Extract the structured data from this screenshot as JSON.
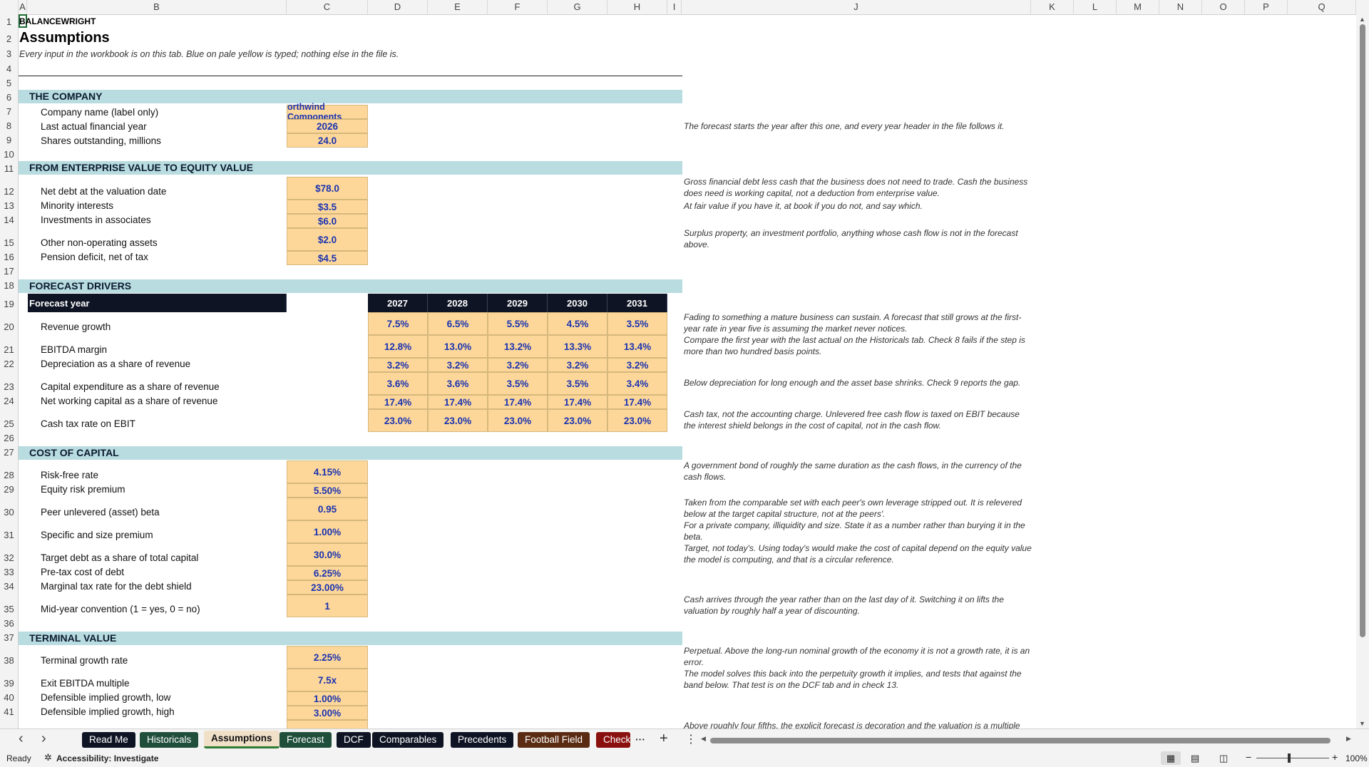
{
  "columns": [
    "A",
    "B",
    "C",
    "D",
    "E",
    "F",
    "G",
    "H",
    "I",
    "J",
    "K",
    "L",
    "M",
    "N",
    "O",
    "P",
    "Q"
  ],
  "rows": [
    "1",
    "2",
    "3",
    "4",
    "5",
    "6",
    "7",
    "8",
    "9",
    "10",
    "11",
    "12",
    "13",
    "14",
    "15",
    "16",
    "17",
    "18",
    "19",
    "20",
    "21",
    "22",
    "23",
    "24",
    "25",
    "26",
    "27",
    "28",
    "29",
    "30",
    "31",
    "32",
    "33",
    "34",
    "35",
    "36",
    "37",
    "38",
    "39",
    "40",
    "41"
  ],
  "brand": "BALANCEWRIGHT",
  "title": "Assumptions",
  "subtitle": "Every input in the workbook is on this tab. Blue on pale yellow is typed; nothing else in the file is.",
  "sections": {
    "company": "THE COMPANY",
    "ev": "FROM ENTERPRISE VALUE TO EQUITY VALUE",
    "drivers": "FORECAST DRIVERS",
    "coc": "COST OF CAPITAL",
    "tv": "TERMINAL VALUE"
  },
  "company": {
    "name_label": "Company name (label only)",
    "name_value": "orthwind Components",
    "year_label": "Last actual financial year",
    "year_value": "2026",
    "shares_label": "Shares outstanding, millions",
    "shares_value": "24.0"
  },
  "ev": {
    "net_debt_label": "Net debt at the valuation date",
    "net_debt_value": "$78.0",
    "minority_label": "Minority interests",
    "minority_value": "$3.5",
    "assoc_label": "Investments in associates",
    "assoc_value": "$6.0",
    "other_label": "Other non-operating assets",
    "other_value": "$2.0",
    "pension_label": "Pension deficit, net of tax",
    "pension_value": "$4.5"
  },
  "drivers": {
    "header_label": "Forecast year",
    "years": [
      "2027",
      "2028",
      "2029",
      "2030",
      "2031"
    ],
    "rows": [
      {
        "label": "Revenue growth",
        "values": [
          "7.5%",
          "6.5%",
          "5.5%",
          "4.5%",
          "3.5%"
        ]
      },
      {
        "label": "EBITDA margin",
        "values": [
          "12.8%",
          "13.0%",
          "13.2%",
          "13.3%",
          "13.4%"
        ]
      },
      {
        "label": "Depreciation as a share of revenue",
        "values": [
          "3.2%",
          "3.2%",
          "3.2%",
          "3.2%",
          "3.2%"
        ]
      },
      {
        "label": "Capital expenditure as a share of revenue",
        "values": [
          "3.6%",
          "3.6%",
          "3.5%",
          "3.5%",
          "3.4%"
        ]
      },
      {
        "label": "Net working capital as a share of revenue",
        "values": [
          "17.4%",
          "17.4%",
          "17.4%",
          "17.4%",
          "17.4%"
        ]
      },
      {
        "label": "Cash tax rate on EBIT",
        "values": [
          "23.0%",
          "23.0%",
          "23.0%",
          "23.0%",
          "23.0%"
        ]
      }
    ]
  },
  "coc": {
    "rf_label": "Risk-free rate",
    "rf_value": "4.15%",
    "erp_label": "Equity risk premium",
    "erp_value": "5.50%",
    "beta_label": "Peer unlevered (asset) beta",
    "beta_value": "0.95",
    "size_label": "Specific and size premium",
    "size_value": "1.00%",
    "debt_share_label": "Target debt as a share of total capital",
    "debt_share_value": "30.0%",
    "kd_label": "Pre-tax cost of debt",
    "kd_value": "6.25%",
    "tax_label": "Marginal tax rate for the debt shield",
    "tax_value": "23.00%",
    "midyear_label": "Mid-year convention (1 = yes, 0 = no)",
    "midyear_value": "1"
  },
  "tv": {
    "g_label": "Terminal growth rate",
    "g_value": "2.25%",
    "exit_label": "Exit EBITDA multiple",
    "exit_value": "7.5x",
    "low_label": "Defensible implied growth, low",
    "low_value": "1.00%",
    "high_label": "Defensible implied growth, high",
    "high_value": "3.00%"
  },
  "notes": {
    "n8": "The forecast starts the year after this one, and every year header in the file follows it.",
    "n12": "Gross financial debt less cash that the business does not need to trade. Cash the business does need is working capital, not a deduction from enterprise value.",
    "n14": "At fair value if you have it, at book if you do not, and say which.",
    "n15": "Surplus property, an investment portfolio, anything whose cash flow is not in the forecast above.",
    "n20": "Fading to something a mature business can sustain. A forecast that still grows at the first-year rate in year five is assuming the market never notices.",
    "n21": "Compare the first year with the last actual on the Historicals tab. Check 8 fails if the step is more than two hundred basis points.",
    "n23": "Below depreciation for long enough and the asset base shrinks. Check 9 reports the gap.",
    "n25": "Cash tax, not the accounting charge. Unlevered free cash flow is taxed on EBIT because the interest shield belongs in the cost of capital, not in the cash flow.",
    "n28": "A government bond of roughly the same duration as the cash flows, in the currency of the cash flows.",
    "n30": "Taken from the comparable set with each peer's own leverage stripped out. It is relevered below at the target capital structure, not at the peers'.",
    "n31": "For a private company, illiquidity and size. State it as a number rather than burying it in the beta.",
    "n32": "Target, not today's. Using today's would make the cost of capital depend on the equity value the model is computing, and that is a circular reference.",
    "n35": "Cash arrives through the year rather than on the last day of it. Switching it on lifts the valuation by roughly half a year of discounting.",
    "n38": "Perpetual. Above the long-run nominal growth of the economy it is not a growth rate, it is an error.",
    "n39": "The model solves this back into the perpetuity growth it implies, and tests that against the band below. That test is on the DCF tab and in check 13.",
    "n41": "Above roughly four fifths, the explicit forecast is decoration and the valuation is a multiple"
  },
  "tabs": [
    {
      "label": "Read Me",
      "color": "#0e1424"
    },
    {
      "label": "Historicals",
      "color": "#1f4e3a"
    },
    {
      "label": "Assumptions",
      "color": "#f0e0c8"
    },
    {
      "label": "Forecast",
      "color": "#1f4e3a"
    },
    {
      "label": "DCF",
      "color": "#0e1424"
    },
    {
      "label": "Comparables",
      "color": "#0e1424"
    },
    {
      "label": "Precedents",
      "color": "#0e1424"
    },
    {
      "label": "Football Field",
      "color": "#5a2a12"
    },
    {
      "label": "Check",
      "color": "#8a1010"
    }
  ],
  "tabbar": {
    "prev": "‹",
    "next": "›",
    "more": "···",
    "add": "+",
    "options": "⋮"
  },
  "status": {
    "ready": "Ready",
    "accessibility": "Accessibility: Investigate",
    "zoom": "100%"
  }
}
